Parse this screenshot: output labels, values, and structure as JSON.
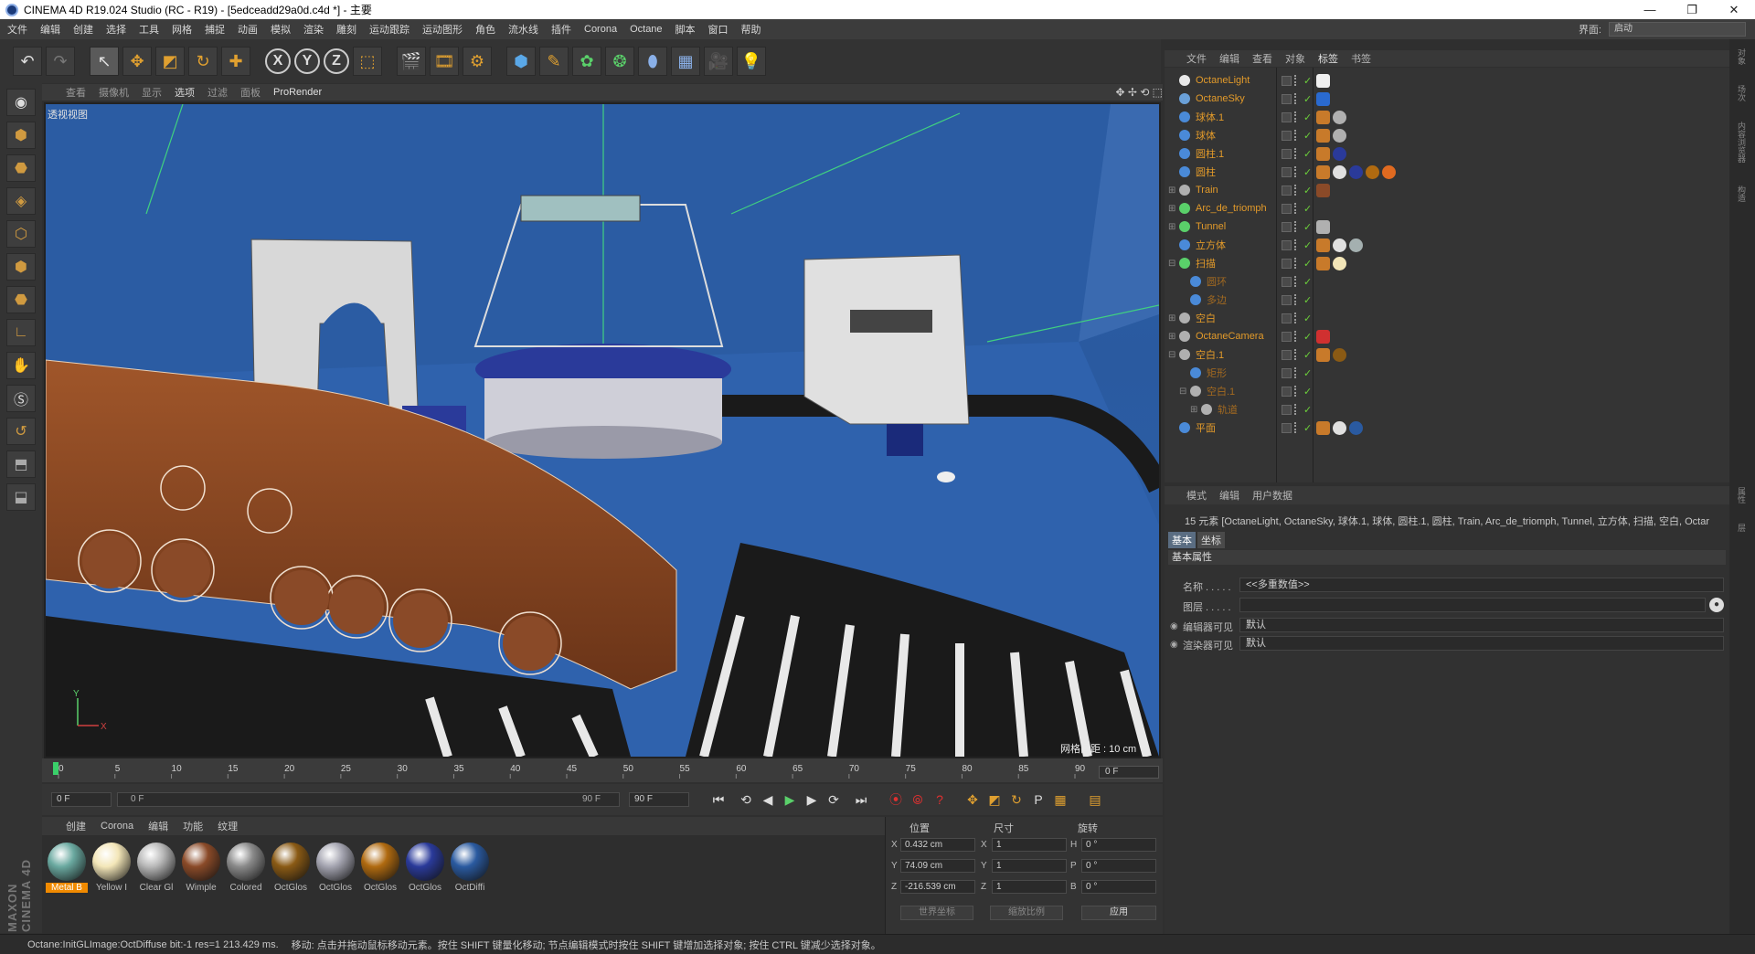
{
  "window": {
    "title": "CINEMA 4D R19.024 Studio (RC - R19) - [5edceadd29a0d.c4d *] - 主要",
    "minimize": "—",
    "maximize": "❐",
    "close": "✕"
  },
  "menubar": {
    "items": [
      "文件",
      "编辑",
      "创建",
      "选择",
      "工具",
      "网格",
      "捕捉",
      "动画",
      "模拟",
      "渲染",
      "雕刻",
      "运动跟踪",
      "运动图形",
      "角色",
      "流水线",
      "插件",
      "Corona",
      "Octane",
      "脚本",
      "窗口",
      "帮助"
    ],
    "layout_label": "界面:",
    "layout_value": "启动"
  },
  "toolbar": {
    "undo": "↶",
    "redo": "↷",
    "select": "↖",
    "move": "✥",
    "scale": "◩",
    "rotate": "↻",
    "add": "✚",
    "x": "X",
    "y": "Y",
    "z": "Z",
    "coord": "⬚",
    "render1": "🎬",
    "render2": "🎞",
    "render3": "⚙",
    "cube": "⬢",
    "pen": "✎",
    "gear": "✿",
    "atom": "❂",
    "deform": "⬮",
    "floor": "▦",
    "camera": "🎥",
    "light": "💡"
  },
  "lefttools": [
    "◉",
    "⬢",
    "⬣",
    "◈",
    "⬡",
    "⬢",
    "⬣",
    "∟",
    "✋",
    "Ⓢ",
    "↺",
    "⬒",
    "⬓"
  ],
  "brand": "MAXON CINEMA 4D",
  "viewport": {
    "menu": [
      "查看",
      "摄像机",
      "显示",
      "选项",
      "过滤",
      "面板"
    ],
    "active_menu": "选项",
    "prorender": "ProRender",
    "label": "透视视图",
    "grid_distance": "网格间距 : 10 cm",
    "nav_icons": "✥ ✢ ⟲ ⬚",
    "axis_y": "Y",
    "axis_x": "X"
  },
  "timeline": {
    "ticks": [
      "0",
      "5",
      "10",
      "15",
      "20",
      "25",
      "30",
      "35",
      "40",
      "45",
      "50",
      "55",
      "60",
      "65",
      "70",
      "75",
      "80",
      "85",
      "90"
    ],
    "current_frame": "0 F",
    "start": "0 F",
    "range_start": "0 F",
    "range_end": "90 F",
    "end": "90 F"
  },
  "transport": {
    "to_start": "⏮",
    "prev_key": "⟲",
    "prev": "◀",
    "play": "▶",
    "next": "▶",
    "next_key": "⟳",
    "to_end": "⏭",
    "rec1": "⦿",
    "rec2": "⦾",
    "rec3": "?",
    "k_move": "✥",
    "k_scale": "◩",
    "k_rot": "↻",
    "k_p": "P",
    "k_grid": "▦",
    "k_tl": "▤"
  },
  "materials": {
    "menu": [
      "创建",
      "Corona",
      "编辑",
      "功能",
      "纹理"
    ],
    "items": [
      {
        "name": "Metal B",
        "color": "#6aa9a0",
        "selected": true
      },
      {
        "name": "Yellow I",
        "color": "#f3e6b8",
        "selected": false
      },
      {
        "name": "Clear Gl",
        "color": "#b8b8b8",
        "selected": false
      },
      {
        "name": "Wimple",
        "color": "#8a4a28",
        "selected": false
      },
      {
        "name": "Colored",
        "color": "#8a8a8a",
        "selected": false
      },
      {
        "name": "OctGlos",
        "color": "#8a5a14",
        "selected": false
      },
      {
        "name": "OctGlos",
        "color": "#a4a4b0",
        "selected": false
      },
      {
        "name": "OctGlos",
        "color": "#b06a10",
        "selected": false
      },
      {
        "name": "OctGlos",
        "color": "#2a3a9a",
        "selected": false
      },
      {
        "name": "OctDiffi",
        "color": "#2a5aa0",
        "selected": false
      }
    ]
  },
  "coordinates": {
    "headers": [
      "位置",
      "尺寸",
      "旋转"
    ],
    "rows": [
      {
        "axis": "X",
        "pos": "0.432 cm",
        "size_axis": "X",
        "size": "1",
        "rot_axis": "H",
        "rot": "0 °"
      },
      {
        "axis": "Y",
        "pos": "74.09 cm",
        "size_axis": "Y",
        "size": "1",
        "rot_axis": "P",
        "rot": "0 °"
      },
      {
        "axis": "Z",
        "pos": "-216.539 cm",
        "size_axis": "Z",
        "size": "1",
        "rot_axis": "B",
        "rot": "0 °"
      }
    ],
    "world": "世界坐标",
    "scale": "缩放比例",
    "apply": "应用"
  },
  "status": {
    "left": "Octane:InitGLImage:OctDiffuse  bit:-1 res=1  213.429 ms.",
    "right": "移动: 点击并拖动鼠标移动元素。按住 SHIFT 键量化移动; 节点编辑模式时按住 SHIFT 键增加选择对象; 按住 CTRL 键减少选择对象。"
  },
  "object_manager": {
    "menu": [
      "文件",
      "编辑",
      "查看",
      "对象",
      "标签",
      "书签"
    ],
    "active_menu": "标签",
    "objects": [
      {
        "name": "OctaneLight",
        "icon": "#e8e8e8",
        "indent": 0,
        "exp": "",
        "tags": [
          "#f0f0f0"
        ]
      },
      {
        "name": "OctaneSky",
        "icon": "#6aa0d8",
        "indent": 0,
        "exp": "",
        "tags": [
          "#2a6ad0"
        ]
      },
      {
        "name": "球体.1",
        "icon": "#4a8ad8",
        "indent": 0,
        "exp": "",
        "tags": [
          "#c87a2a",
          "#b0b0b0"
        ]
      },
      {
        "name": "球体",
        "icon": "#4a8ad8",
        "indent": 0,
        "exp": "",
        "tags": [
          "#c87a2a",
          "#b0b0b0"
        ]
      },
      {
        "name": "圆柱.1",
        "icon": "#4a8ad8",
        "indent": 0,
        "exp": "",
        "tags": [
          "#c87a2a",
          "#2a3a9a"
        ]
      },
      {
        "name": "圆柱",
        "icon": "#4a8ad8",
        "indent": 0,
        "exp": "",
        "tags": [
          "#c87a2a",
          "#e0e0e0",
          "#2a3a9a",
          "#b06a10",
          "#e06a20"
        ]
      },
      {
        "name": "Train",
        "icon": "#b0b0b0",
        "indent": 0,
        "exp": "⊞",
        "tags": [
          "#8a4a28"
        ]
      },
      {
        "name": "Arc_de_triomph",
        "icon": "#5ad06a",
        "indent": 0,
        "exp": "⊞",
        "tags": []
      },
      {
        "name": "Tunnel",
        "icon": "#5ad06a",
        "indent": 0,
        "exp": "⊞",
        "tags": [
          "#b0b0b0"
        ]
      },
      {
        "name": "立方体",
        "icon": "#4a8ad8",
        "indent": 0,
        "exp": "",
        "tags": [
          "#c87a2a",
          "#e0e0e0",
          "#a4b0b0"
        ]
      },
      {
        "name": "扫描",
        "icon": "#5ad06a",
        "indent": 0,
        "exp": "⊟",
        "tags": [
          "#c87a2a",
          "#f3e6b8"
        ]
      },
      {
        "name": "圆环",
        "icon": "#4a8ad8",
        "indent": 1,
        "exp": "",
        "tags": [],
        "dim": true
      },
      {
        "name": "多边",
        "icon": "#4a8ad8",
        "indent": 1,
        "exp": "",
        "tags": [],
        "dim": true
      },
      {
        "name": "空白",
        "icon": "#b0b0b0",
        "indent": 0,
        "exp": "⊞",
        "tags": []
      },
      {
        "name": "OctaneCamera",
        "icon": "#b0b0b0",
        "indent": 0,
        "exp": "⊞",
        "tags": [
          "#d03030"
        ]
      },
      {
        "name": "空白.1",
        "icon": "#b0b0b0",
        "indent": 0,
        "exp": "⊟",
        "tags": [
          "#c87a2a",
          "#8a5a14"
        ]
      },
      {
        "name": "矩形",
        "icon": "#4a8ad8",
        "indent": 1,
        "exp": "",
        "tags": [],
        "dim": true
      },
      {
        "name": "空白.1",
        "icon": "#b0b0b0",
        "indent": 1,
        "exp": "⊟",
        "tags": [],
        "dim": true
      },
      {
        "name": "轨道",
        "icon": "#b0b0b0",
        "indent": 2,
        "exp": "⊞",
        "tags": [],
        "dim": true
      },
      {
        "name": "平面",
        "icon": "#4a8ad8",
        "indent": 0,
        "exp": "",
        "tags": [
          "#c87a2a",
          "#e0e0e0",
          "#2a5aa0"
        ]
      }
    ]
  },
  "attribute_manager": {
    "menu": [
      "模式",
      "编辑",
      "用户数据"
    ],
    "info": "15 元素 [OctaneLight, OctaneSky, 球体.1, 球体, 圆柱.1, 圆柱, Train, Arc_de_triomph, Tunnel, 立方体, 扫描, 空白, Octar",
    "tabs": [
      "基本",
      "坐标"
    ],
    "section": "基本属性",
    "name_label": "名称 . . . . .",
    "name_value": "<<多重数值>>",
    "layer_label": "图层 . . . . .",
    "layer_value": "",
    "editor_vis_label": "编辑器可见",
    "editor_vis_value": "默认",
    "render_vis_label": "渲染器可见",
    "render_vis_value": "默认"
  },
  "right_strip": [
    "对象",
    "场次",
    "内容浏览器",
    "构造",
    "属性",
    "层"
  ]
}
